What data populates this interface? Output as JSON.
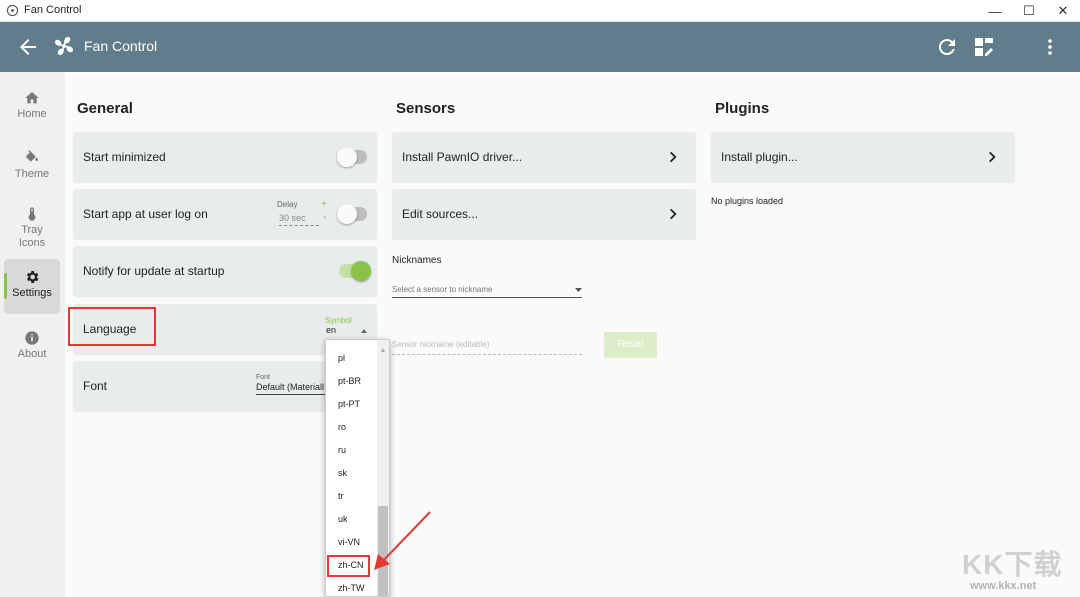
{
  "window": {
    "title": "Fan Control",
    "minimize": "—",
    "maximize": "☐",
    "close": "✕"
  },
  "appbar": {
    "title": "Fan Control",
    "icons": [
      "back-arrow-icon",
      "fan-icon",
      "refresh-icon",
      "dashboard-edit-icon",
      "more-vert-icon"
    ]
  },
  "sidebar": {
    "items": [
      {
        "label": "Home",
        "icon": "home-icon"
      },
      {
        "label": "Theme",
        "icon": "paint-bucket-icon"
      },
      {
        "label": "Tray Icons",
        "line1": "Tray",
        "line2": "Icons",
        "icon": "thermometer-icon"
      },
      {
        "label": "Settings",
        "icon": "gear-icon",
        "active": true
      },
      {
        "label": "About",
        "icon": "info-icon"
      }
    ]
  },
  "general": {
    "title": "General",
    "start_minimized": "Start minimized",
    "start_app": "Start app at user log on",
    "delay_label": "Delay",
    "delay_value": "30 sec",
    "delay_plus": "+",
    "delay_minus": "-",
    "notify_update": "Notify for update at startup",
    "language": "Language",
    "symbol_label": "Symbol",
    "symbol_value": "en",
    "font": "Font",
    "font_label": "Font",
    "font_value": "Default (Materiall"
  },
  "sensors": {
    "title": "Sensors",
    "install_pawnio": "Install PawnIO driver...",
    "edit_sources": "Edit sources...",
    "nicknames": "Nicknames",
    "select_placeholder": "Select a sensor to nickname",
    "nickname_placeholder": "Sensor nickname (editable)",
    "reset": "Reset"
  },
  "plugins": {
    "title": "Plugins",
    "install_plugin": "Install plugin...",
    "none_loaded": "No plugins loaded"
  },
  "language_options": [
    "pl",
    "pt-BR",
    "pt-PT",
    "ro",
    "ru",
    "sk",
    "tr",
    "uk",
    "vi-VN",
    "zh-CN",
    "zh-TW"
  ],
  "states": {
    "start_minimized": false,
    "start_app": false,
    "notify_update": true
  },
  "colors": {
    "appbar": "#617d8b",
    "accent": "#8bc34a",
    "highlight": "#e53935"
  },
  "watermark": {
    "brand": "KK下载",
    "url": "www.kkx.net"
  }
}
